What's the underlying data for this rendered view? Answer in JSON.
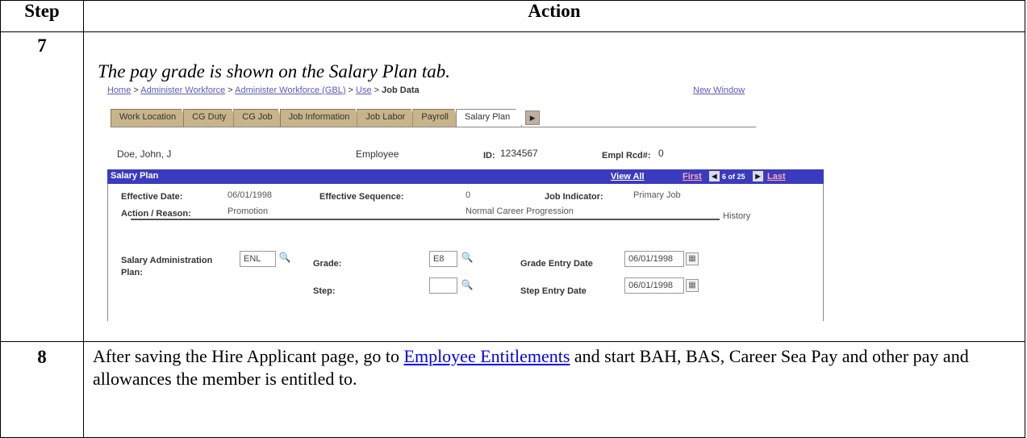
{
  "table": {
    "headers": {
      "step": "Step",
      "action": "Action"
    },
    "row7": {
      "step": "7",
      "caption": "The pay grade is shown on the Salary Plan tab."
    },
    "row8": {
      "step": "8",
      "text_before": "After saving the Hire Applicant page, go to ",
      "link": "Employee Entitlements",
      "text_after": " and start BAH, BAS, Career Sea Pay and other pay and allowances the member is entitled to."
    }
  },
  "screenshot": {
    "breadcrumb": {
      "items": [
        "Home",
        "Administer Workforce",
        "Administer Workforce (GBL)",
        "Use"
      ],
      "separator": " > ",
      "current": "Job Data"
    },
    "new_window": "New Window",
    "tabs": [
      "Work Location",
      "CG Duty",
      "CG Job",
      "Job Information",
      "Job Labor",
      "Payroll",
      "Salary Plan"
    ],
    "active_tab": "Salary Plan",
    "tab_next_icon": "right-arrow-icon",
    "employee": {
      "name": "Doe, John, J",
      "type": "Employee",
      "id_label": "ID:",
      "id": "1234567",
      "rcd_label": "Empl Rcd#:",
      "rcd": "0"
    },
    "section": {
      "title": "Salary Plan",
      "view_all": "View All",
      "first": "First",
      "count": "6 of 25",
      "last": "Last"
    },
    "effective_date_label": "Effective Date:",
    "effective_date": "06/01/1998",
    "effective_sequence_label": "Effective Sequence:",
    "effective_sequence": "0",
    "job_indicator_label": "Job Indicator:",
    "job_indicator": "Primary Job",
    "action_reason_label": "Action / Reason:",
    "action": "Promotion",
    "reason": "Normal Career Progression",
    "history": "History",
    "salary_admin_label_1": "Salary Administration",
    "salary_admin_label_2": "Plan:",
    "salary_admin_value": "ENL",
    "grade_label": "Grade:",
    "grade_value": "E8",
    "step_label": "Step:",
    "step_value": "",
    "grade_entry_label": "Grade Entry Date",
    "grade_entry_value": "06/01/1998",
    "step_entry_label": "Step Entry Date",
    "step_entry_value": "06/01/1998",
    "lookup_glyph": "🔍",
    "calendar_glyph": "▦"
  }
}
